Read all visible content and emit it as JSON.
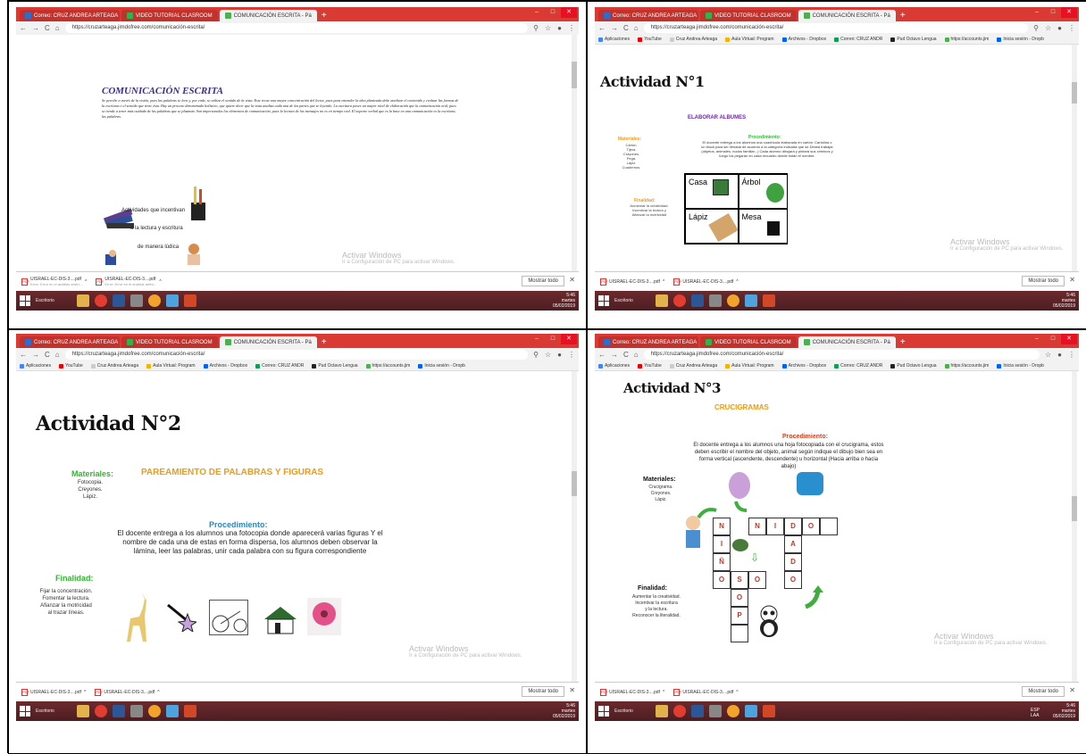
{
  "panels": {
    "p1": {
      "tabs": [
        "Correo: CRUZ ANDREA ARTEAGA",
        "VIDEO TUTORIAL CLASROOM",
        "COMUNICACIÓN ESCRITA - Pá"
      ],
      "url": "https://cruzarteaga.jimdofree.com/comunicación-escrita/",
      "heading": "COMUNICACIÓN ESCRITA",
      "body": "Se percibe a través de la visión, pues las palabras se leen y, por ende, se utiliza el sentido de la vista. Este recae una mayor concentración del lector, pues para entender la idea planteada debe analizar el contenido y evaluar las formas de la escritura o el sentido que tiene ésta. Hay un proceso denominado holístico, que quiere decir que la vista analiza cada una de las partes que se leyendo. La escritura posee un mayor nivel de elaboración que la comunicación oral, pues se tiende a tener más cuidado de las palabras que se plasman. Son impersonales los elementos de comunicación, pues la lectura de los mensajes no es en tiempo real. El soporte verbal que es la base en una comunicación es la escritura, las palabras.",
      "lines": [
        "Actividades que incentivan",
        "a la lectura y escritura",
        "de manera lúdica"
      ],
      "downloads": [
        "UISRAEL-EC-DIS-3....pdf",
        "UISRAEL-EC-DIS-3....pdf"
      ],
      "dl_sub": "Error: Error en el análisis antivi...",
      "show_all": "Mostrar todo",
      "activar": "Activar Windows",
      "activar_sub": "Ir a Configuración de PC para activar Windows.",
      "taskbar_label": "Escritorio",
      "time": "5:46",
      "day": "martes",
      "date": "05/02/2019"
    },
    "p2": {
      "tabs": [
        "Correo: CRUZ ANDREA ARTEAGA",
        "VIDEO TUTORIAL CLASROOM",
        "COMUNICACIÓN ESCRITA - Pá"
      ],
      "url": "https://cruzarteaga.jimdofree.com/comunicación-escrita/",
      "bookmarks": [
        "Aplicaciones",
        "YouTube",
        "Cruz Andrea Arteaga",
        "Aula Virtual: Program",
        "Archivos - Dropbox",
        "Correo: CRUZ ANDR",
        "Pud Octavo Lengua",
        "https://accounts.jim",
        "Inicia sesión - Dropb"
      ],
      "title": "Actividad N°1",
      "subtitle": "ELABORAR ALBUMES",
      "materiales": "Materiales:",
      "materiales_list": [
        "Cartón.",
        "Tijera.",
        "Crayones.",
        "Pega.",
        "Lápiz.",
        "Cuadernos."
      ],
      "proc_title": "Procedimiento:",
      "proc_text": "El docente entrega a los alumnos una cuadrícula elaborada en cartón. Cartulina o un block para ser llenada de acuerdo a la categoría indicada que se Desea trabajar (objetos, animales, nodos familiar...) Cada alumno dibujará y pintará sus criminos y luego los pegarán en cada recuadro donde están el nombre.",
      "finalidad": "Finalidad:",
      "finalidad_list": [
        "Aumentar la creatividad.",
        "Incentivar la lectura y",
        "Afianzar la motricidad"
      ],
      "words": [
        "Casa",
        "Árbol",
        "Lápiz",
        "Mesa"
      ],
      "downloads": [
        "UISRAEL-EC-DIS-3....pdf",
        "UISRAEL-EC-DIS-3....pdf"
      ],
      "show_all": "Mostrar todo",
      "activar": "Activar Windows",
      "activar_sub": "Ir a Configuración de PC para activar Windows.",
      "taskbar_label": "Escritorio",
      "time": "5:46",
      "day": "martes",
      "date": "05/02/2019"
    },
    "p3": {
      "tabs": [
        "Correo: CRUZ ANDREA ARTEAGA",
        "VIDEO TUTORIAL CLASROOM",
        "COMUNICACIÓN ESCRITA - Pá"
      ],
      "url": "https://cruzarteaga.jimdofree.com/comunicación-escrita/",
      "bookmarks": [
        "Aplicaciones",
        "YouTube",
        "Cruz Andrea Arteaga",
        "Aula Virtual: Program",
        "Archivos - Dropbox",
        "Correo: CRUZ ANDR",
        "Pud Octavo Lengua",
        "https://accounts.jim",
        "Inicia sesión - Dropb"
      ],
      "title": "Actividad N°2",
      "subtitle": "PAREAMIENTO DE PALABRAS Y FIGURAS",
      "materiales": "Materiales:",
      "materiales_list": [
        "Fotocopia.",
        "Creyones.",
        "Lápiz."
      ],
      "proc_title": "Procedimiento:",
      "proc_text": "El docente entrega a los alumnos una fotocopia donde aparecerá varias figuras Y el nombre de cada una de estas en forma dispersa, los alumnos deben observar la lámina, leer las palabras, unir cada palabra con su figura correspondiente",
      "finalidad": "Finalidad:",
      "finalidad_list": [
        "Fijar la concentración.",
        "Fomentar la lectura.",
        "Afianzar la motricidad",
        "al trazar  líneas."
      ],
      "downloads": [
        "UISRAEL-EC-DIS-3....pdf",
        "UISRAEL-EC-DIS-3....pdf"
      ],
      "show_all": "Mostrar todo",
      "activar": "Activar Windows",
      "activar_sub": "Ir a Configuración de PC para activar Windows.",
      "taskbar_label": "Escritorio",
      "time": "5:46",
      "day": "martes",
      "date": "05/02/2019"
    },
    "p4": {
      "tabs": [
        "Correo: CRUZ ANDREA ARTEAGA",
        "VIDEO TUTORIAL CLASROOM",
        "COMUNICACIÓN ESCRITA - Pá"
      ],
      "url": "https://cruzarteaga.jimdofree.com/comunicación-escrita/",
      "bookmarks": [
        "Aplicaciones",
        "YouTube",
        "Cruz Andrea Arteaga",
        "Aula Virtual: Program",
        "Archivos - Dropbox",
        "Correo: CRUZ ANDR",
        "Pud Octavo Lengua",
        "https://accounts.jim",
        "Inicia sesión - Dropb"
      ],
      "title": "Actividad N°3",
      "subtitle": "CRUCIGRAMAS",
      "proc_title": "Procedimiento:",
      "proc_text": "El docente entrega a los alumnos una hoja fotocopiada con el crucigrama, estos deben escribir el nombre del objeto, animal según indique el dibujo bien sea en forma vertical (ascendente, descendente) u horizontal (Hacia arriba o hacia abajo)",
      "materiales": "Materiales:",
      "materiales_list": [
        "Crucigrama.",
        "Creyones.",
        "Lápiz."
      ],
      "finalidad": "Finalidad:",
      "finalidad_list": [
        "Aumentar la creatividad.",
        "Incentivar la escritura",
        "y la  lectura.",
        "Reconocer la literalidad."
      ],
      "cw_row1": [
        "N",
        "I",
        "D",
        "O"
      ],
      "cw_col1": [
        "I",
        "Ñ",
        "O"
      ],
      "cw_row2": [
        "S",
        "O",
        "O"
      ],
      "cw_colA": [
        "A",
        "D"
      ],
      "cw_col2": [
        "O",
        "P"
      ],
      "cw_first": "N",
      "downloads": [
        "UISRAEL-EC-DIS-3....pdf",
        "UISRAEL-EC-DIS-3....pdf"
      ],
      "show_all": "Mostrar todo",
      "activar": "Activar Windows",
      "activar_sub": "Ir a Configuración de PC para activar Windows.",
      "taskbar_label": "Escritorio",
      "lang": "ESP",
      "lang2": "LAA",
      "time": "5:46",
      "day": "martes",
      "date": "05/02/2019"
    }
  }
}
